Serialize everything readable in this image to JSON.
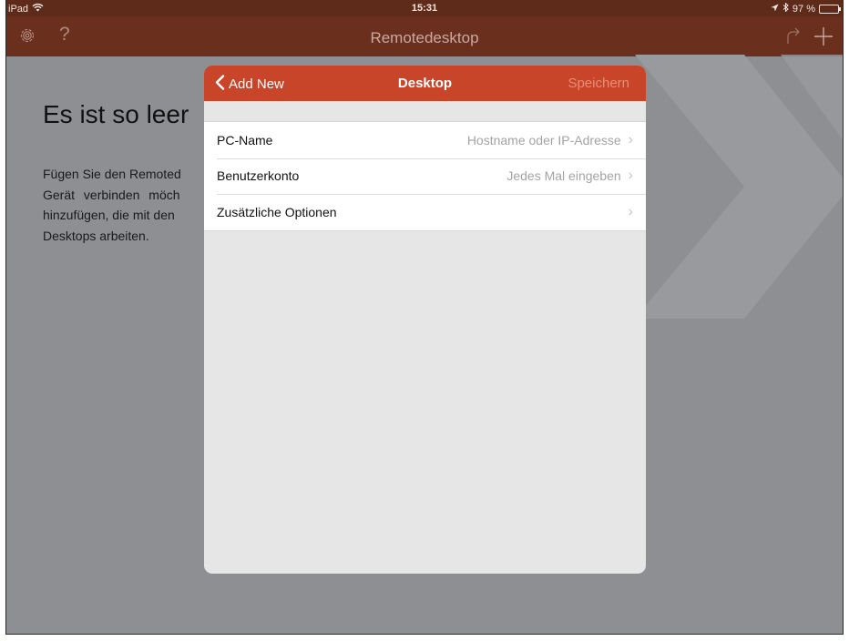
{
  "status_bar": {
    "device": "iPad",
    "time": "15:31",
    "battery": "97 %",
    "battery_level": 0.97
  },
  "nav_bar": {
    "title": "Remotedesktop",
    "left_icons": [
      "gear-icon",
      "help-icon"
    ],
    "right_icons": [
      "share-icon",
      "plus-icon"
    ]
  },
  "background": {
    "heading": "Es ist so leer",
    "body_lines": [
      "Fügen Sie den Remoted",
      "Gerät verbinden möch",
      "hinzufügen, die mit den",
      "Desktops arbeiten."
    ]
  },
  "modal": {
    "back_label": "Add New",
    "title": "Desktop",
    "save_label": "Speichern",
    "rows": [
      {
        "label": "PC-Name",
        "value": "Hostname oder IP-Adresse"
      },
      {
        "label": "Benutzerkonto",
        "value": "Jedes Mal eingeben"
      },
      {
        "label": "Zusätzliche Optionen",
        "value": ""
      }
    ]
  },
  "colors": {
    "nav_bar": "#6b2f1e",
    "modal_header": "#c8452a",
    "overlay": "#8e8f93"
  }
}
